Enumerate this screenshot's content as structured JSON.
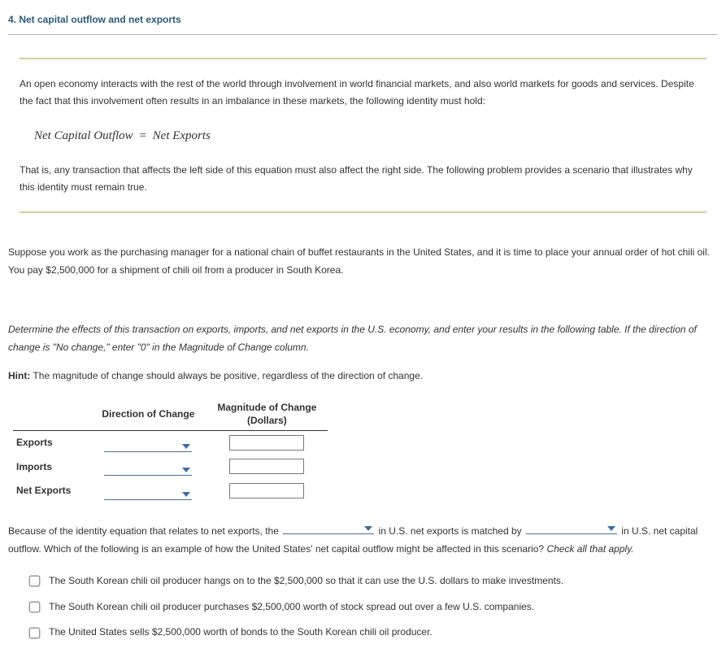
{
  "title": "4. Net capital outflow and net exports",
  "intro": "An open economy interacts with the rest of the world through involvement in world financial markets, and also world markets for goods and services. Despite the fact that this involvement often results in an imbalance in these markets, the following identity must hold:",
  "equation_lhs": "Net Capital Outflow",
  "equation_rhs": "Net Exports",
  "after_equation": "That is, any transaction that affects the left side of this equation must also affect the right side. The following problem provides a scenario that illustrates why this identity must remain true.",
  "scenario": "Suppose you work as the purchasing manager for a national chain of buffet restaurants in the United States, and it is time to place your annual order of hot chili oil. You pay $2,500,000 for a shipment of chili oil from a producer in South Korea.",
  "instructions": "Determine the effects of this transaction on exports, imports, and net exports in the U.S. economy, and enter your results in the following table. If the direction of change is \"No change,\" enter \"0\" in the Magnitude of Change column.",
  "hint_label": "Hint:",
  "hint_text": " The magnitude of change should always be positive, regardless of the direction of change.",
  "table": {
    "col_direction": "Direction of Change",
    "col_magnitude_line1": "Magnitude of Change",
    "col_magnitude_line2": "(Dollars)",
    "rows": [
      {
        "label": "Exports"
      },
      {
        "label": "Imports"
      },
      {
        "label": "Net Exports"
      }
    ]
  },
  "followup": {
    "part1": "Because of the identity equation that relates to net exports, the ",
    "part2": " in U.S. net exports is matched by ",
    "part3": " in U.S. net capital outflow. Which of the following is an example of how the United States' net capital outflow might be affected in this scenario? ",
    "tail_italic": "Check all that apply."
  },
  "options": [
    "The South Korean chili oil producer hangs on to the $2,500,000 so that it can use the U.S. dollars to make investments.",
    "The South Korean chili oil producer purchases $2,500,000 worth of stock spread out over a few U.S. companies.",
    "The United States sells $2,500,000 worth of bonds to the South Korean chili oil producer."
  ]
}
